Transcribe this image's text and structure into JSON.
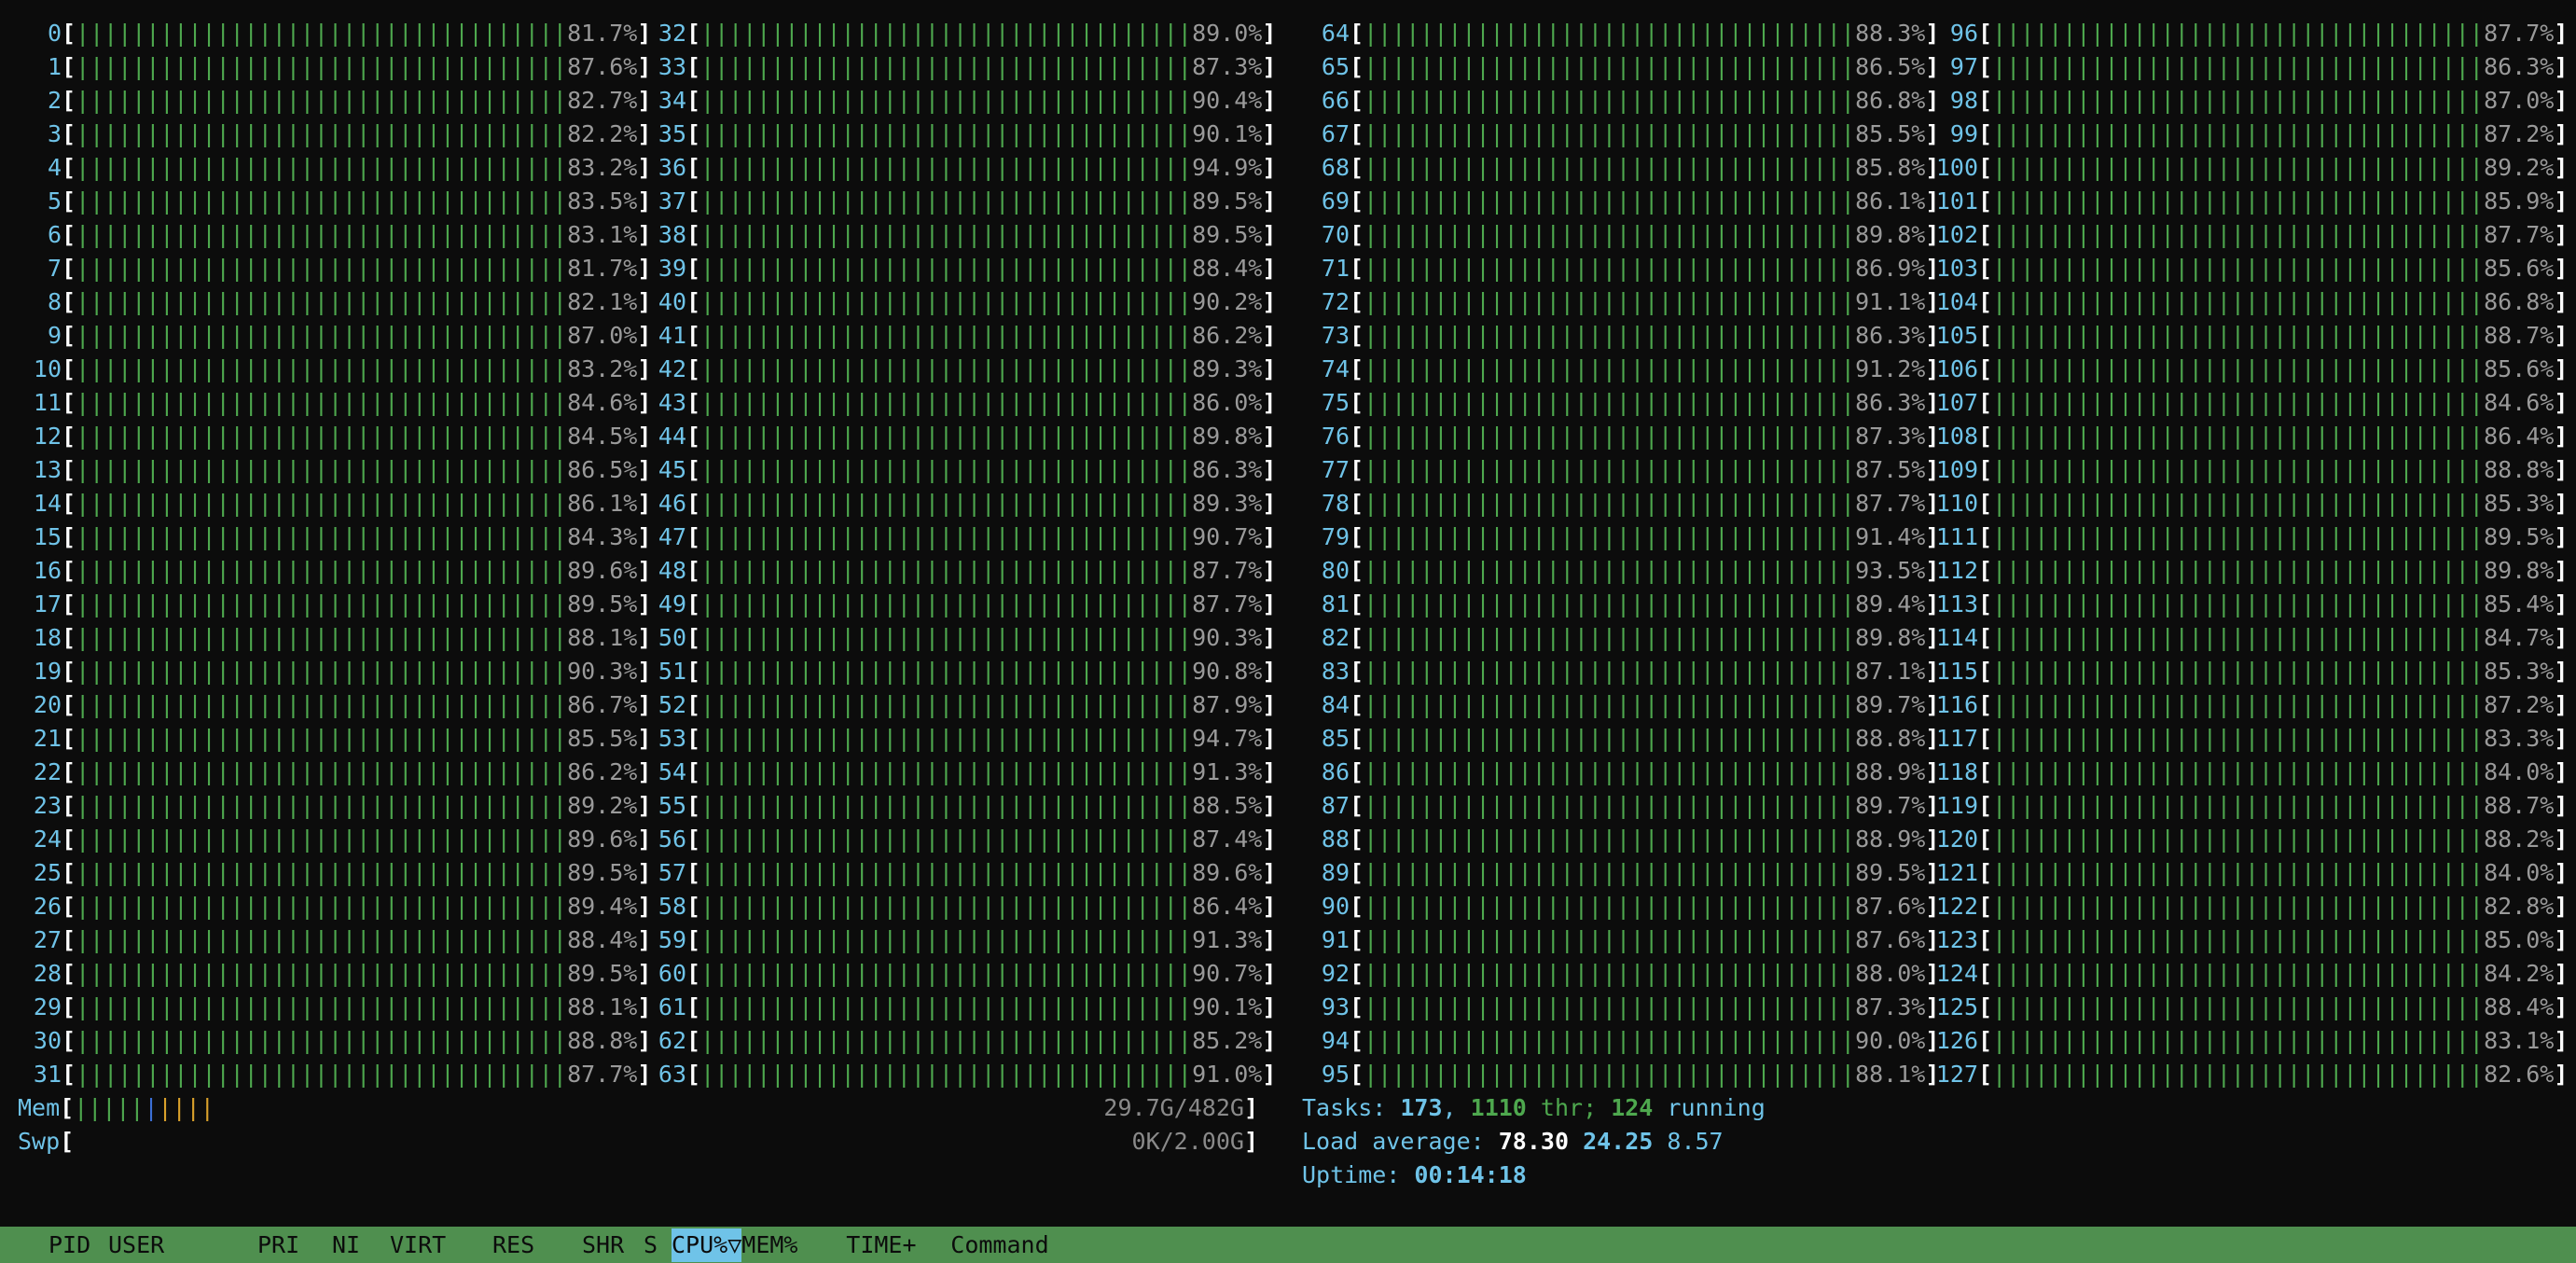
{
  "cpus": [
    {
      "id": "0",
      "pct": "81.7"
    },
    {
      "id": "1",
      "pct": "87.6"
    },
    {
      "id": "2",
      "pct": "82.7"
    },
    {
      "id": "3",
      "pct": "82.2"
    },
    {
      "id": "4",
      "pct": "83.2"
    },
    {
      "id": "5",
      "pct": "83.5"
    },
    {
      "id": "6",
      "pct": "83.1"
    },
    {
      "id": "7",
      "pct": "81.7"
    },
    {
      "id": "8",
      "pct": "82.1"
    },
    {
      "id": "9",
      "pct": "87.0"
    },
    {
      "id": "10",
      "pct": "83.2"
    },
    {
      "id": "11",
      "pct": "84.6"
    },
    {
      "id": "12",
      "pct": "84.5"
    },
    {
      "id": "13",
      "pct": "86.5"
    },
    {
      "id": "14",
      "pct": "86.1"
    },
    {
      "id": "15",
      "pct": "84.3"
    },
    {
      "id": "16",
      "pct": "89.6"
    },
    {
      "id": "17",
      "pct": "89.5"
    },
    {
      "id": "18",
      "pct": "88.1"
    },
    {
      "id": "19",
      "pct": "90.3"
    },
    {
      "id": "20",
      "pct": "86.7"
    },
    {
      "id": "21",
      "pct": "85.5"
    },
    {
      "id": "22",
      "pct": "86.2"
    },
    {
      "id": "23",
      "pct": "89.2"
    },
    {
      "id": "24",
      "pct": "89.6"
    },
    {
      "id": "25",
      "pct": "89.5"
    },
    {
      "id": "26",
      "pct": "89.4"
    },
    {
      "id": "27",
      "pct": "88.4"
    },
    {
      "id": "28",
      "pct": "89.5"
    },
    {
      "id": "29",
      "pct": "88.1"
    },
    {
      "id": "30",
      "pct": "88.8"
    },
    {
      "id": "31",
      "pct": "87.7"
    },
    {
      "id": "32",
      "pct": "89.0"
    },
    {
      "id": "33",
      "pct": "87.3"
    },
    {
      "id": "34",
      "pct": "90.4"
    },
    {
      "id": "35",
      "pct": "90.1"
    },
    {
      "id": "36",
      "pct": "94.9"
    },
    {
      "id": "37",
      "pct": "89.5"
    },
    {
      "id": "38",
      "pct": "89.5"
    },
    {
      "id": "39",
      "pct": "88.4"
    },
    {
      "id": "40",
      "pct": "90.2"
    },
    {
      "id": "41",
      "pct": "86.2"
    },
    {
      "id": "42",
      "pct": "89.3"
    },
    {
      "id": "43",
      "pct": "86.0"
    },
    {
      "id": "44",
      "pct": "89.8"
    },
    {
      "id": "45",
      "pct": "86.3"
    },
    {
      "id": "46",
      "pct": "89.3"
    },
    {
      "id": "47",
      "pct": "90.7"
    },
    {
      "id": "48",
      "pct": "87.7"
    },
    {
      "id": "49",
      "pct": "87.7"
    },
    {
      "id": "50",
      "pct": "90.3"
    },
    {
      "id": "51",
      "pct": "90.8"
    },
    {
      "id": "52",
      "pct": "87.9"
    },
    {
      "id": "53",
      "pct": "94.7"
    },
    {
      "id": "54",
      "pct": "91.3"
    },
    {
      "id": "55",
      "pct": "88.5"
    },
    {
      "id": "56",
      "pct": "87.4"
    },
    {
      "id": "57",
      "pct": "89.6"
    },
    {
      "id": "58",
      "pct": "86.4"
    },
    {
      "id": "59",
      "pct": "91.3"
    },
    {
      "id": "60",
      "pct": "90.7"
    },
    {
      "id": "61",
      "pct": "90.1"
    },
    {
      "id": "62",
      "pct": "85.2"
    },
    {
      "id": "63",
      "pct": "91.0"
    },
    {
      "id": "64",
      "pct": "88.3"
    },
    {
      "id": "65",
      "pct": "86.5"
    },
    {
      "id": "66",
      "pct": "86.8"
    },
    {
      "id": "67",
      "pct": "85.5"
    },
    {
      "id": "68",
      "pct": "85.8"
    },
    {
      "id": "69",
      "pct": "86.1"
    },
    {
      "id": "70",
      "pct": "89.8"
    },
    {
      "id": "71",
      "pct": "86.9"
    },
    {
      "id": "72",
      "pct": "91.1"
    },
    {
      "id": "73",
      "pct": "86.3"
    },
    {
      "id": "74",
      "pct": "91.2"
    },
    {
      "id": "75",
      "pct": "86.3"
    },
    {
      "id": "76",
      "pct": "87.3"
    },
    {
      "id": "77",
      "pct": "87.5"
    },
    {
      "id": "78",
      "pct": "87.7"
    },
    {
      "id": "79",
      "pct": "91.4"
    },
    {
      "id": "80",
      "pct": "93.5"
    },
    {
      "id": "81",
      "pct": "89.4"
    },
    {
      "id": "82",
      "pct": "89.8"
    },
    {
      "id": "83",
      "pct": "87.1"
    },
    {
      "id": "84",
      "pct": "89.7"
    },
    {
      "id": "85",
      "pct": "88.8"
    },
    {
      "id": "86",
      "pct": "88.9"
    },
    {
      "id": "87",
      "pct": "89.7"
    },
    {
      "id": "88",
      "pct": "88.9"
    },
    {
      "id": "89",
      "pct": "89.5"
    },
    {
      "id": "90",
      "pct": "87.6"
    },
    {
      "id": "91",
      "pct": "87.6"
    },
    {
      "id": "92",
      "pct": "88.0"
    },
    {
      "id": "93",
      "pct": "87.3"
    },
    {
      "id": "94",
      "pct": "90.0"
    },
    {
      "id": "95",
      "pct": "88.1"
    },
    {
      "id": "96",
      "pct": "87.7"
    },
    {
      "id": "97",
      "pct": "86.3"
    },
    {
      "id": "98",
      "pct": "87.0"
    },
    {
      "id": "99",
      "pct": "87.2"
    },
    {
      "id": "100",
      "pct": "89.2"
    },
    {
      "id": "101",
      "pct": "85.9"
    },
    {
      "id": "102",
      "pct": "87.7"
    },
    {
      "id": "103",
      "pct": "85.6"
    },
    {
      "id": "104",
      "pct": "86.8"
    },
    {
      "id": "105",
      "pct": "88.7"
    },
    {
      "id": "106",
      "pct": "85.6"
    },
    {
      "id": "107",
      "pct": "84.6"
    },
    {
      "id": "108",
      "pct": "86.4"
    },
    {
      "id": "109",
      "pct": "88.8"
    },
    {
      "id": "110",
      "pct": "85.3"
    },
    {
      "id": "111",
      "pct": "89.5"
    },
    {
      "id": "112",
      "pct": "89.8"
    },
    {
      "id": "113",
      "pct": "85.4"
    },
    {
      "id": "114",
      "pct": "84.7"
    },
    {
      "id": "115",
      "pct": "85.3"
    },
    {
      "id": "116",
      "pct": "87.2"
    },
    {
      "id": "117",
      "pct": "83.3"
    },
    {
      "id": "118",
      "pct": "84.0"
    },
    {
      "id": "119",
      "pct": "88.7"
    },
    {
      "id": "120",
      "pct": "88.2"
    },
    {
      "id": "121",
      "pct": "84.0"
    },
    {
      "id": "122",
      "pct": "82.8"
    },
    {
      "id": "123",
      "pct": "85.0"
    },
    {
      "id": "124",
      "pct": "84.2"
    },
    {
      "id": "125",
      "pct": "88.4"
    },
    {
      "id": "126",
      "pct": "83.1"
    },
    {
      "id": "127",
      "pct": "82.6"
    }
  ],
  "mem": {
    "label": "Mem",
    "value": "29.7G/482G"
  },
  "swp": {
    "label": "Swp",
    "value": "0K/2.00G"
  },
  "tasks": {
    "label": "Tasks:",
    "count": "173",
    "threads": "1110",
    "thr_label": "thr;",
    "running": "124",
    "running_label": "running"
  },
  "load": {
    "label": "Load average:",
    "one": "78.30",
    "five": "24.25",
    "fifteen": "8.57"
  },
  "uptime": {
    "label": "Uptime:",
    "value": "00:14:18"
  },
  "header": {
    "pid": "PID",
    "user": "USER",
    "pri": "PRI",
    "ni": "NI",
    "virt": "VIRT",
    "res": "RES",
    "shr": "SHR",
    "s": "S",
    "cpu": "CPU%▽",
    "mem": "MEM%",
    "time": "TIME+",
    "command": "Command"
  },
  "colors": {
    "background": "#0c0c0c",
    "user": "#4ea84e",
    "kernel": "#e04848",
    "label": "#6fc3e8",
    "header_bg": "#4f8f4f"
  }
}
